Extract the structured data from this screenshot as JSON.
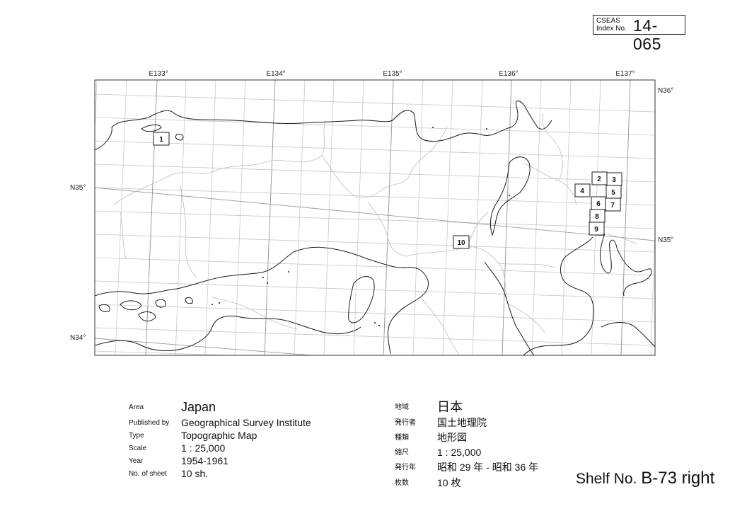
{
  "index": {
    "line1": "CSEAS",
    "line2": "Index No.",
    "number": "14-065"
  },
  "map": {
    "lon_labels": [
      "E133°",
      "E134°",
      "E135°",
      "E136°",
      "E137°"
    ],
    "lat_labels": {
      "n36": "N36°",
      "n35_left": "N35°",
      "n35_right": "N35°",
      "n34": "N34°"
    },
    "sheets": [
      "1",
      "2",
      "3",
      "4",
      "5",
      "6",
      "7",
      "8",
      "9",
      "10"
    ]
  },
  "info_en": {
    "area_label": "Area",
    "area": "Japan",
    "publisher_label": "Published by",
    "publisher": "Geographical Survey Institute",
    "type_label": "Type",
    "type": "Topographic Map",
    "scale_label": "Scale",
    "scale": "1 : 25,000",
    "year_label": "Year",
    "year": "1954-1961",
    "sheets_label": "No. of sheet",
    "sheets": "10 sh."
  },
  "info_jp": {
    "area_label": "地域",
    "area": "日本",
    "publisher_label": "発行者",
    "publisher": "国土地理院",
    "type_label": "種類",
    "type": "地形図",
    "scale_label": "縮尺",
    "scale": "1 : 25,000",
    "year_label": "発行年",
    "year": "昭和 29 年 - 昭和 36 年",
    "sheets_label": "枚数",
    "sheets": "10 枚"
  },
  "shelf": {
    "label": "Shelf No.",
    "code": "B-73 right"
  }
}
